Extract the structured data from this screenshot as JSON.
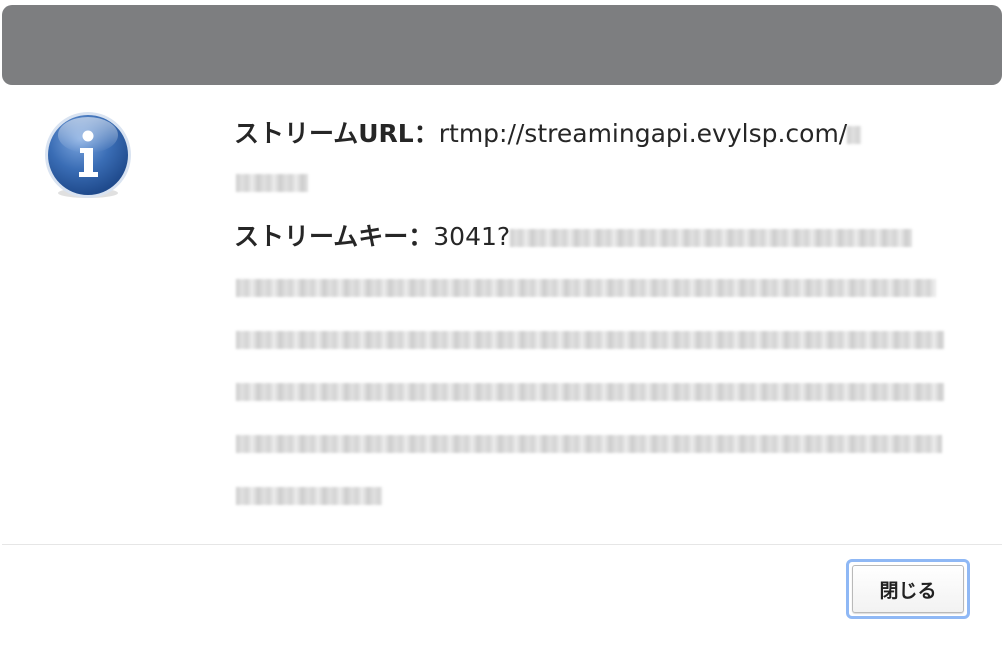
{
  "dialog": {
    "icon": "info-icon",
    "stream_url_label": "ストリームURL：",
    "stream_url_value": "rtmp://streamingapi.evylsp.com/",
    "stream_key_label": "ストリームキー：",
    "stream_key_value": "3041?",
    "close_label": "閉じる"
  },
  "colors": {
    "titlebar": "#7d7e80",
    "focus_ring": "#8fb8f5",
    "info_icon_blue": "#2f62a8"
  }
}
